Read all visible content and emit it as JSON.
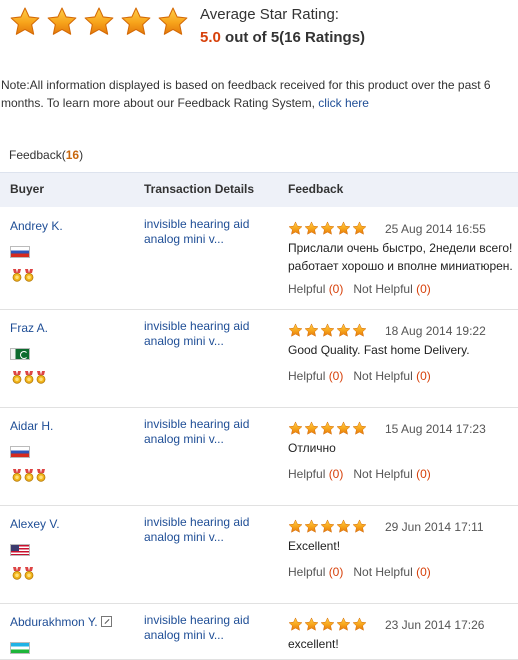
{
  "summary": {
    "rating_value": 5.0,
    "label": "Average Star Rating:",
    "score": "5.0",
    "out_of": " out of 5(16 Ratings)"
  },
  "note": {
    "text": "Note:All information displayed is based on feedback received for this product over the past 6 months. To learn more about our Feedback Rating System, ",
    "link": "click here"
  },
  "feedback_title": {
    "label": "Feedback(",
    "count": "16",
    "close": ")"
  },
  "columns": {
    "buyer": "Buyer",
    "transaction": "Transaction Details",
    "feedback": "Feedback"
  },
  "colors": {
    "accent": "#d7410b",
    "link": "#1f4e96",
    "star": "#f59a12",
    "header_bg": "#eef1f8"
  },
  "rows": [
    {
      "buyer": "Andrey K.",
      "flag": "ru",
      "medals": 2,
      "tx": [
        "invisible hearing aid",
        "analog mini v..."
      ],
      "stars": 5,
      "date": "25 Aug 2014 16:55",
      "comment": [
        "Прислали очень быстро, 2недели всего!",
        "работает хорошо и вполне миниатюрен."
      ],
      "helpful_label": "Helpful",
      "helpful_count": "(0)",
      "not_helpful_label": "Not Helpful",
      "not_helpful_count": "(0)"
    },
    {
      "buyer": "Fraz A.",
      "flag": "pk",
      "medals": 3,
      "tx": [
        "invisible hearing aid",
        "analog mini v..."
      ],
      "stars": 5,
      "date": "18 Aug 2014 19:22",
      "comment": [
        "Good Quality. Fast home Delivery."
      ],
      "helpful_label": "Helpful",
      "helpful_count": "(0)",
      "not_helpful_label": "Not Helpful",
      "not_helpful_count": "(0)"
    },
    {
      "buyer": "Aidar H.",
      "flag": "ru",
      "medals": 3,
      "tx": [
        "invisible hearing aid",
        "analog mini v..."
      ],
      "stars": 5,
      "date": "15 Aug 2014 17:23",
      "comment": [
        "Отлично"
      ],
      "helpful_label": "Helpful",
      "helpful_count": "(0)",
      "not_helpful_label": "Not Helpful",
      "not_helpful_count": "(0)"
    },
    {
      "buyer": "Alexey V.",
      "flag": "us",
      "medals": 2,
      "tx": [
        "invisible hearing aid",
        "analog mini v..."
      ],
      "stars": 5,
      "date": "29 Jun 2014 17:11",
      "comment": [
        "Excellent!"
      ],
      "helpful_label": "Helpful",
      "helpful_count": "(0)",
      "not_helpful_label": "Not Helpful",
      "not_helpful_count": "(0)"
    },
    {
      "buyer": "Abdurakhmon Y.",
      "flag": "uz",
      "medals": 0,
      "tx": [
        "invisible hearing aid",
        "analog mini v..."
      ],
      "stars": 5,
      "date": "23 Jun 2014 17:26",
      "comment": [
        "excellent!"
      ],
      "helpful_label": "",
      "helpful_count": "",
      "not_helpful_label": "",
      "not_helpful_count": ""
    }
  ]
}
